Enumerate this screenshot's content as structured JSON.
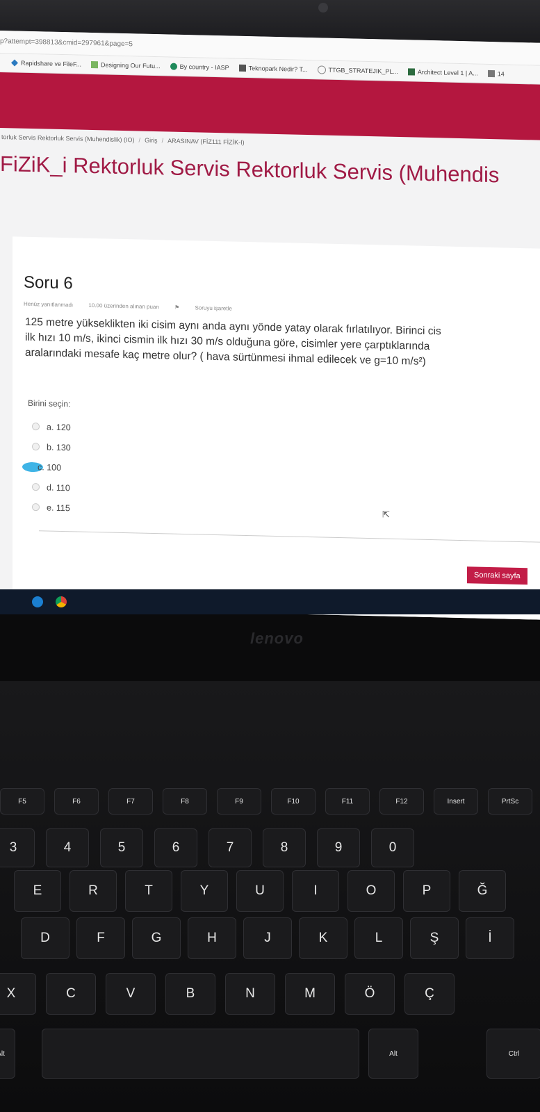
{
  "browser": {
    "url": "p?attempt=398813&cmid=297961&page=5",
    "bookmarks": [
      {
        "label": "Rapidshare ve FileF..."
      },
      {
        "label": "Designing Our Futu..."
      },
      {
        "label": "By country - IASP"
      },
      {
        "label": "Teknopark Nedir? T..."
      },
      {
        "label": "TTGB_STRATEJIK_PL..."
      },
      {
        "label": "Architect Level 1 | A..."
      },
      {
        "label": "14"
      }
    ]
  },
  "breadcrumb": {
    "course": "torluk Servis Rektorluk Servis (Muhendislik) (IO)",
    "home": "Giriş",
    "exam": "ARASINAV (FİZ111 FİZİK-I)"
  },
  "course_title": "FiZiK_i Rektorluk Servis Rektorluk Servis (Muhendis",
  "question": {
    "title": "Soru 6",
    "status": "Henüz yanıtlanmadı",
    "points": "10.00 üzerinden alınan puan",
    "flag": "Soruyu işaretle",
    "text_line1": "125 metre yükseklikten iki cisim aynı anda aynı yönde yatay olarak fırlatılıyor. Birinci cis",
    "text_line2": "ilk hızı 10 m/s, ikinci cismin ilk hızı 30 m/s olduğuna göre, cisimler yere çarptıklarında",
    "text_line3": "aralarındaki mesafe kaç metre olur? ( hava sürtünmesi ihmal edilecek ve g=10 m/s²)",
    "prompt": "Birini seçin:",
    "options": [
      {
        "label": "a. 120"
      },
      {
        "label": "b. 130"
      },
      {
        "label": "c. 100"
      },
      {
        "label": "d. 110"
      },
      {
        "label": "e. 115"
      }
    ]
  },
  "next_button": "Sonraki sayfa",
  "laptop_brand": "lenovo",
  "keyboard": {
    "fn_row": [
      "F5",
      "F6",
      "F7",
      "F8",
      "F9",
      "F10",
      "F11",
      "F12",
      "Insert",
      "PrtSc"
    ],
    "number_row": [
      "3",
      "4",
      "5",
      "6",
      "7",
      "8",
      "9",
      "0"
    ],
    "row_q": [
      "E",
      "R",
      "T",
      "Y",
      "U",
      "I",
      "O",
      "P",
      "Ğ"
    ],
    "row_a": [
      "D",
      "F",
      "G",
      "H",
      "J",
      "K",
      "L",
      "Ş",
      "İ"
    ],
    "row_z": [
      "X",
      "C",
      "V",
      "B",
      "N",
      "M",
      "Ö",
      "Ç"
    ],
    "bottom": [
      "Alt",
      "Ctrl",
      "Alt"
    ]
  },
  "colors": {
    "accent": "#b4173f",
    "title": "#a01a45",
    "button": "#c21d47"
  }
}
